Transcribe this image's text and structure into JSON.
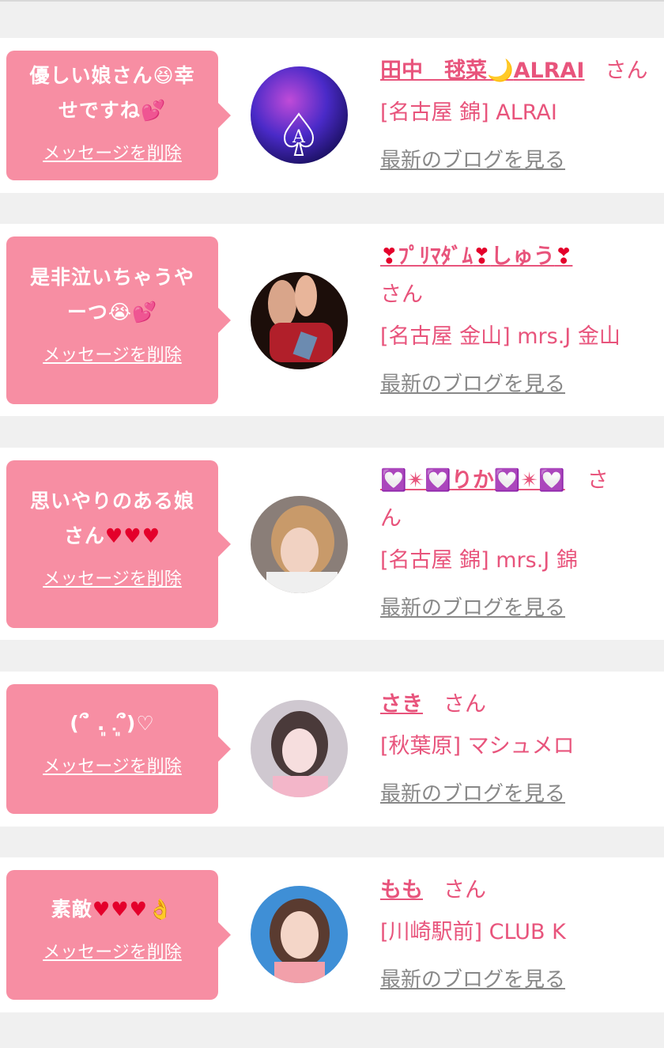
{
  "delete_label": "メッセージを削除",
  "blog_label": "最新のブログを見る",
  "accent_color": "#e8547c",
  "bubble_color": "#f78ea3",
  "items": [
    {
      "message_a": "優しい娘さん",
      "message_emoji1": "😆",
      "message_b": "幸",
      "message_c": "せですね",
      "message_emoji2": "💕",
      "name": "田中　毬菜",
      "name_emoji": "🌙",
      "name_suffix": "ALRAI",
      "san": "さん",
      "shop": "[名古屋 錦] ALRAI",
      "avatar_icon": "spade-ace-avatar"
    },
    {
      "message_a": "是非泣いちゃうや",
      "message_b": "ーつ",
      "message_emoji1": "😭",
      "message_emoji2": "💕",
      "name_h1": "❣",
      "name_a": "ﾌﾟﾘﾏﾀﾞﾑ",
      "name_h2": "❣",
      "name_b": "しゅう",
      "name_h3": "❣",
      "san": "さん",
      "shop": "[名古屋 金山] mrs.J 金山",
      "avatar_icon": "photo-avatar"
    },
    {
      "message_a": "思いやりのある娘",
      "message_b": "さん",
      "message_hearts": "♥♥♥",
      "name_a": "💟✴💟",
      "name_b": "りか",
      "name_c": "💟✴💟",
      "san_a": "さ",
      "san_b": "ん",
      "shop": "[名古屋 錦] mrs.J 錦",
      "avatar_icon": "photo-avatar"
    },
    {
      "message_a": "(՞ ܸ. .ܸ՞)♡",
      "name": "さき",
      "san": "さん",
      "shop": "[秋葉原] マシュメロ",
      "avatar_icon": "photo-avatar"
    },
    {
      "message_a": "素敵",
      "message_hearts": "♥♥♥",
      "message_emoji1": "👌",
      "name": "もも",
      "san": "さん",
      "shop": "[川崎駅前] CLUB K",
      "avatar_icon": "photo-avatar"
    }
  ]
}
